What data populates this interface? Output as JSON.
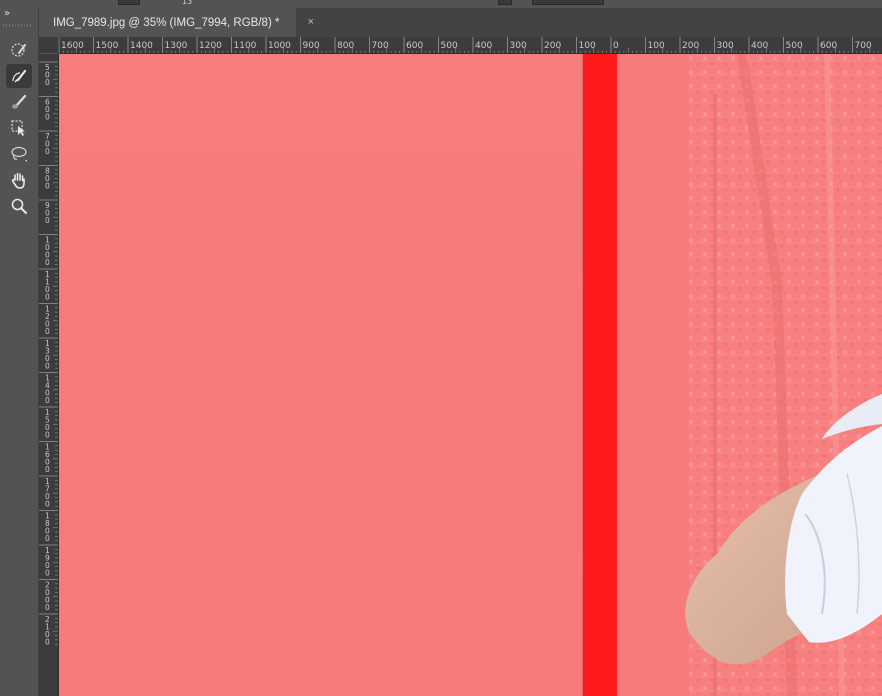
{
  "toolbar": {
    "collapse_glyph": "»",
    "tools": [
      {
        "name": "quick-selection-icon",
        "active": false
      },
      {
        "name": "refine-edge-brush-icon",
        "active": true
      },
      {
        "name": "brush-icon",
        "active": false
      },
      {
        "name": "object-selection-icon",
        "active": false
      },
      {
        "name": "lasso-icon",
        "active": false
      },
      {
        "name": "hand-icon",
        "active": false
      },
      {
        "name": "zoom-icon",
        "active": false
      }
    ]
  },
  "options_bar": {
    "partial_value": "13"
  },
  "document": {
    "tab_title": "IMG_7989.jpg @ 35% (IMG_7994, RGB/8) *",
    "close_glyph": "×"
  },
  "ruler": {
    "horizontal_labels": [
      "1600",
      "1500",
      "1400",
      "1300",
      "1200",
      "1100",
      "1000",
      "900",
      "800",
      "700",
      "600",
      "500",
      "400",
      "300",
      "200",
      "100",
      "0",
      "100",
      "200",
      "300",
      "400",
      "500",
      "600",
      "700"
    ],
    "vertical_labels": [
      "500",
      "600",
      "700",
      "800",
      "900",
      "1000",
      "1100",
      "1200",
      "1300",
      "1400",
      "1500",
      "1600",
      "1700",
      "1800",
      "1900",
      "2000",
      "2100"
    ]
  },
  "colors": {
    "overlay": "#f77b7b",
    "overlay_bar": "#fe1a1a",
    "ui_panel": "#535353",
    "ruler": "#3c3c3c"
  }
}
